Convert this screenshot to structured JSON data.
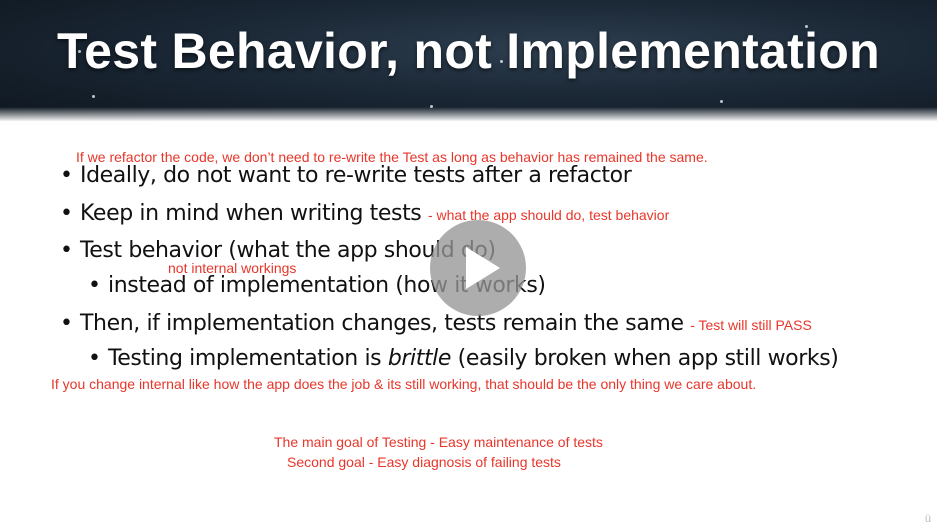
{
  "slide": {
    "title": "Test Behavior, not Implementation",
    "top_note": "If we refactor the code, we don’t need to re-write the Test as long as behavior has remained the same.",
    "bullets": [
      {
        "marker": "•",
        "text": "Ideally, do not want to re-write tests after a refactor"
      },
      {
        "marker": "•",
        "text": "Keep in mind when writing tests",
        "note": "- what the app should do, test behavior"
      },
      {
        "marker": "•",
        "text": "Test behavior (what the app should do)"
      },
      {
        "marker": "•",
        "text": "instead of implementation (how it works)"
      },
      {
        "marker": "•",
        "text": "Then, if implementation changes, tests remain the same",
        "note": "- Test will still PASS"
      },
      {
        "marker": "•",
        "text_before": "Testing implementation is ",
        "text_emph": "brittle",
        "text_after": " (easily broken when app still works)"
      }
    ],
    "note_internal": "not internal workings",
    "note_change": "If you change internal like how the app does the job & its still working, that should be the only thing we care about.",
    "goal_main": "The main goal of Testing - Easy maintenance of tests",
    "goal_second": "Second goal - Easy diagnosis of failing tests",
    "watermark": "ü"
  },
  "player": {
    "play_icon": "play-icon"
  },
  "colors": {
    "annotation": "#e8362a",
    "header_bg": "#1b2836",
    "text": "#111111"
  }
}
